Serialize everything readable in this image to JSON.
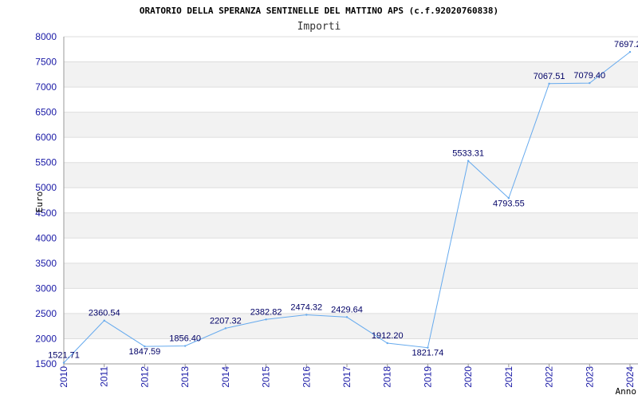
{
  "chart_data": {
    "type": "line",
    "title": "ORATORIO DELLA SPERANZA SENTINELLE DEL MATTINO APS (c.f.92020760838)",
    "subtitle": "Importi",
    "xlabel": "Anno",
    "ylabel": "Euro",
    "x": [
      "2010",
      "2011",
      "2012",
      "2013",
      "2014",
      "2015",
      "2016",
      "2017",
      "2018",
      "2019",
      "2020",
      "2021",
      "2022",
      "2023",
      "2024"
    ],
    "series": [
      {
        "values": [
          1521.71,
          2360.54,
          1847.59,
          1856.4,
          2207.32,
          2382.82,
          2474.32,
          2429.64,
          1912.2,
          1821.74,
          5533.31,
          4793.55,
          7067.51,
          7079.4,
          7697.2
        ]
      }
    ],
    "data_labels": [
      "1521.71",
      "2360.54",
      "1847.59",
      "1856.40",
      "2207.32",
      "2382.82",
      "2474.32",
      "2429.64",
      "1912.20",
      "1821.74",
      "5533.31",
      "4793.55",
      "7067.51",
      "7079.40",
      "7697.2"
    ],
    "ylim": [
      1500,
      8000
    ],
    "yticks": [
      "1500",
      "2000",
      "2500",
      "3000",
      "3500",
      "4000",
      "4500",
      "5000",
      "5500",
      "6000",
      "6500",
      "7000",
      "7500",
      "8000"
    ],
    "grid": true,
    "colors": {
      "line": "#66aaee",
      "band": "#f2f2f2",
      "grid": "#dddddd",
      "tick_text": "#1a1aa6",
      "label_text": "#000066"
    }
  }
}
